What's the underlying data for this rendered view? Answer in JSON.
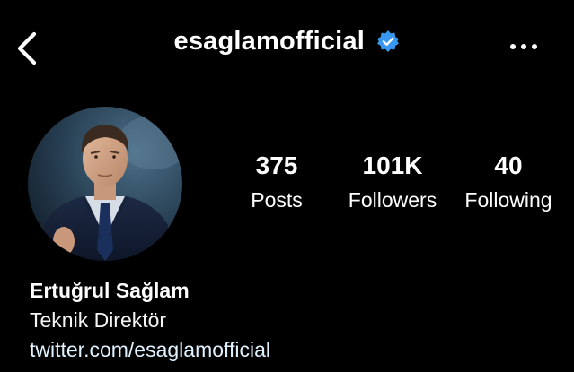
{
  "header": {
    "username": "esaglamofficial",
    "verified": true,
    "back_icon": "chevron-left-icon",
    "more_icon": "more-horizontal-icon",
    "accent_color": "#3897f0"
  },
  "profile": {
    "avatar": "profile-photo",
    "stats": [
      {
        "value": "375",
        "label": "Posts"
      },
      {
        "value": "101K",
        "label": "Followers"
      },
      {
        "value": "40",
        "label": "Following"
      }
    ],
    "bio": {
      "name": "Ertuğrul Sağlam",
      "role": "Teknik Direktör",
      "link": "twitter.com/esaglamofficial"
    }
  }
}
